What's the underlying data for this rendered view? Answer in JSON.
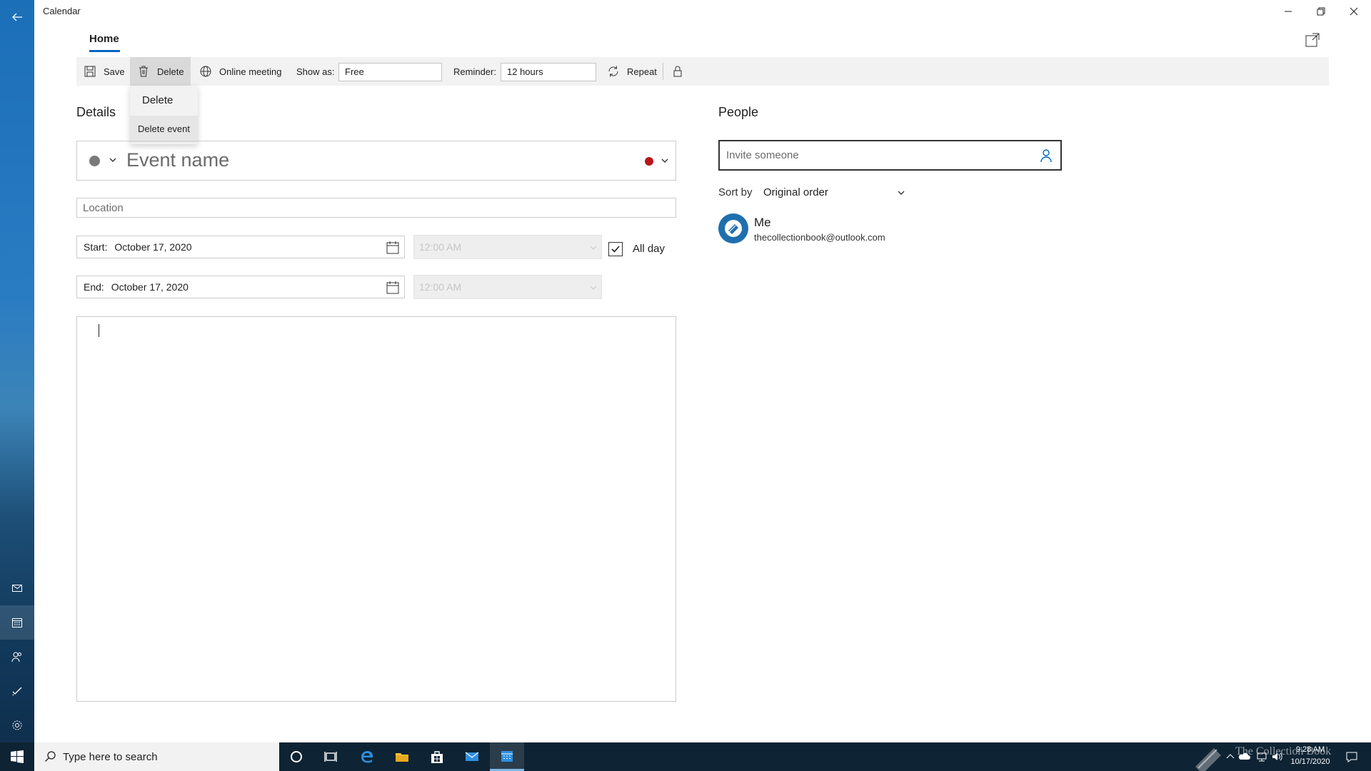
{
  "window": {
    "title": "Calendar"
  },
  "ribbon": {
    "tab_home": "Home",
    "save": "Save",
    "delete": "Delete",
    "online_meeting": "Online meeting",
    "show_as_label": "Show as:",
    "show_as_value": "Free",
    "reminder_label": "Reminder:",
    "reminder_value": "12 hours",
    "repeat": "Repeat"
  },
  "delete_menu": {
    "items": [
      "Delete",
      "Delete event"
    ]
  },
  "details": {
    "title": "Details",
    "event_name_placeholder": "Event name",
    "location_placeholder": "Location",
    "start_label": "Start:",
    "start_date": "October 17, 2020",
    "start_time": "12:00 AM",
    "end_label": "End:",
    "end_date": "October 17, 2020",
    "end_time": "12:00 AM",
    "all_day_label": "All day",
    "all_day_checked": true
  },
  "people": {
    "title": "People",
    "invite_placeholder": "Invite someone",
    "sort_by_label": "Sort by",
    "sort_by_value": "Original order",
    "attendees": [
      {
        "name": "Me",
        "email": "thecollectionbook@outlook.com"
      }
    ]
  },
  "taskbar": {
    "search_placeholder": "Type here to search",
    "time": "9:28 AM",
    "date": "10/17/2020",
    "watermark": "The Collection Book"
  },
  "colors": {
    "accent": "#0067c0",
    "category_red": "#b8161c",
    "rail_blue": "#1b6fb8",
    "taskbar": "#0e2333"
  },
  "icons": {
    "rail": [
      "back-arrow-icon",
      "mail-icon",
      "calendar-icon",
      "people-icon",
      "todo-icon",
      "settings-icon"
    ],
    "toolbar": [
      "save-icon",
      "trash-icon",
      "globe-icon",
      "repeat-icon",
      "lock-icon"
    ],
    "window": [
      "minimize-icon",
      "restore-icon",
      "close-icon",
      "popout-icon"
    ]
  }
}
